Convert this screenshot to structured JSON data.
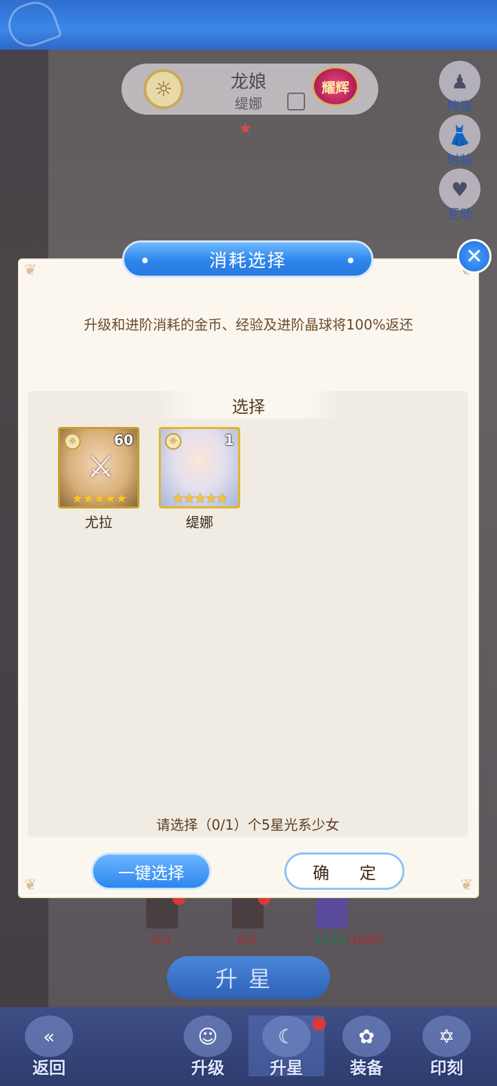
{
  "hero": {
    "class_name": "龙娘",
    "name": "缇娜",
    "rank_badge": "耀辉"
  },
  "side_menu": [
    {
      "label": "阵容",
      "icon": "pawn-icon"
    },
    {
      "label": "时装",
      "icon": "dress-icon"
    },
    {
      "label": "互动",
      "icon": "heart-icon"
    }
  ],
  "materials": [
    {
      "count": "0/1"
    },
    {
      "count": "0/1"
    },
    {
      "have": "1014",
      "need": "/1000"
    }
  ],
  "upstar_button": "升星",
  "bottom_nav": [
    {
      "label": "返回",
      "icon": "back-arrow-icon"
    },
    {
      "label": "升级",
      "icon": "portrait-icon"
    },
    {
      "label": "升星",
      "icon": "moon-star-icon",
      "active": true
    },
    {
      "label": "装备",
      "icon": "equipment-icon"
    },
    {
      "label": "印刻",
      "icon": "hexagram-icon"
    }
  ],
  "dialog": {
    "title": "消耗选择",
    "notice": "升级和进阶消耗的金币、经验及进阶晶球将100%返还",
    "section_title": "选择",
    "cards": [
      {
        "name": "尤拉",
        "level": "60",
        "stars": 5,
        "locked": true
      },
      {
        "name": "缇娜",
        "level": "1",
        "stars": 5,
        "locked": false
      }
    ],
    "hint": "请选择（0/1）个5星光系少女",
    "auto_select_button": "一键选择",
    "confirm_button": "确 定"
  },
  "colors": {
    "accent_blue": "#2c86ee",
    "dialog_bg": "#fbf7ef",
    "text_brown": "#5a3e22",
    "star_gold": "#f7c531",
    "alert_red": "#d83a3a"
  }
}
